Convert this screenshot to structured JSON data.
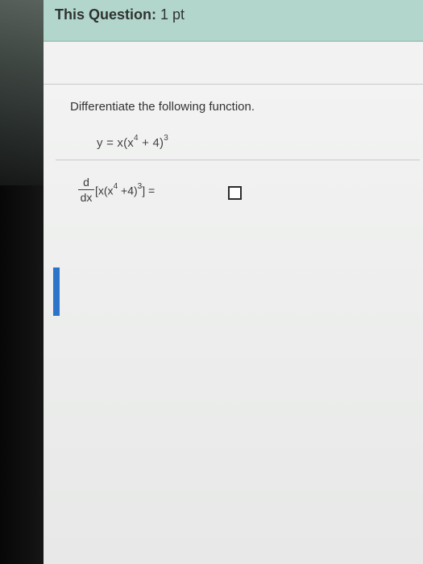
{
  "header": {
    "title_bold": "This Question:",
    "points": "1 pt"
  },
  "question": {
    "instruction": "Differentiate the following function.",
    "function": {
      "lhs": "y = x(x",
      "exp_inner": "4",
      "mid": " + 4)",
      "exp_outer": "3"
    },
    "derivative": {
      "numerator": "d",
      "denominator": "dx",
      "expr_start": "[x(x",
      "exp_inner": "4",
      "expr_mid": " +4)",
      "exp_outer": "3",
      "expr_end": "] ="
    }
  },
  "colors": {
    "header_bg": "#b3d6cc",
    "accent_bar": "#2b74c9"
  }
}
